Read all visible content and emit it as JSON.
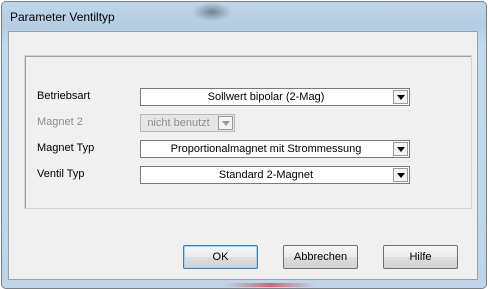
{
  "window": {
    "title": "Parameter Ventiltyp"
  },
  "fields": [
    {
      "label": "Betriebsart",
      "value": "Sollwert bipolar  (2-Mag)",
      "enabled": true
    },
    {
      "label": "Magnet 2",
      "value": "nicht benutzt",
      "enabled": false
    },
    {
      "label": "Magnet Typ",
      "value": "Proportionalmagnet mit Strommessung",
      "enabled": true
    },
    {
      "label": "Ventil Typ",
      "value": "Standard 2-Magnet",
      "enabled": true
    }
  ],
  "buttons": {
    "ok": "OK",
    "cancel": "Abbrechen",
    "help": "Hilfe"
  },
  "colors": {
    "frame": "#bfd6ea",
    "client": "#f0f0f0",
    "disabled_text": "#8c8c8c"
  }
}
